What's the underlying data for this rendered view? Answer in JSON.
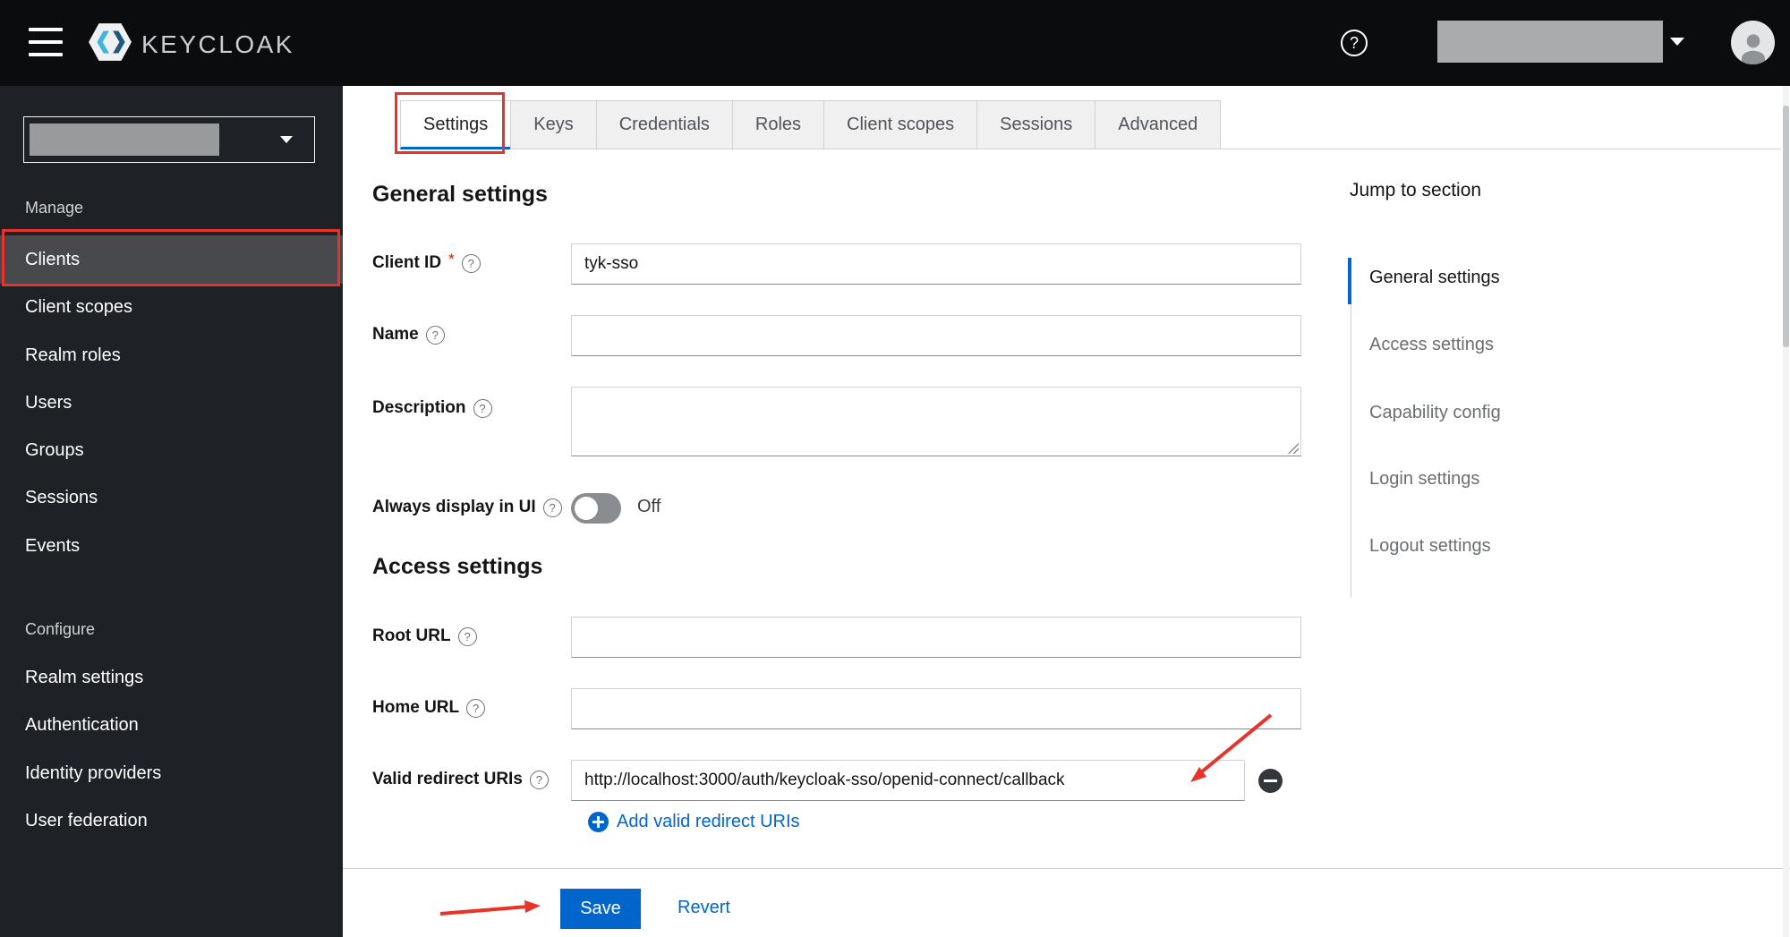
{
  "header": {
    "brand": "KEYCLOAK"
  },
  "help_icon": "?",
  "sidebar": {
    "sections": [
      {
        "label": "Manage",
        "items": [
          "Clients",
          "Client scopes",
          "Realm roles",
          "Users",
          "Groups",
          "Sessions",
          "Events"
        ]
      },
      {
        "label": "Configure",
        "items": [
          "Realm settings",
          "Authentication",
          "Identity providers",
          "User federation"
        ]
      }
    ],
    "selected_item": "Clients"
  },
  "tabs": {
    "items": [
      "Settings",
      "Keys",
      "Credentials",
      "Roles",
      "Client scopes",
      "Sessions",
      "Advanced"
    ],
    "active": "Settings"
  },
  "general": {
    "heading": "General settings",
    "client_id": {
      "label": "Client ID",
      "required_marker": "*",
      "value": "tyk-sso"
    },
    "name": {
      "label": "Name",
      "value": ""
    },
    "description": {
      "label": "Description",
      "value": ""
    },
    "always_display": {
      "label": "Always display in UI",
      "state_label": "Off"
    }
  },
  "access": {
    "heading": "Access settings",
    "root_url": {
      "label": "Root URL",
      "value": ""
    },
    "home_url": {
      "label": "Home URL",
      "value": ""
    },
    "redirect_uris": {
      "label": "Valid redirect URIs",
      "value": "http://localhost:3000/auth/keycloak-sso/openid-connect/callback",
      "add_label": "Add valid redirect URIs"
    }
  },
  "jump": {
    "title": "Jump to section",
    "items": [
      "General settings",
      "Access settings",
      "Capability config",
      "Login settings",
      "Logout settings"
    ],
    "active": "General settings"
  },
  "actions": {
    "save": "Save",
    "revert": "Revert"
  },
  "colors": {
    "primary": "#0066cc",
    "annotation": "#e8332a",
    "header_bg": "#0b0c0e",
    "sidebar_bg": "#1e2125"
  }
}
